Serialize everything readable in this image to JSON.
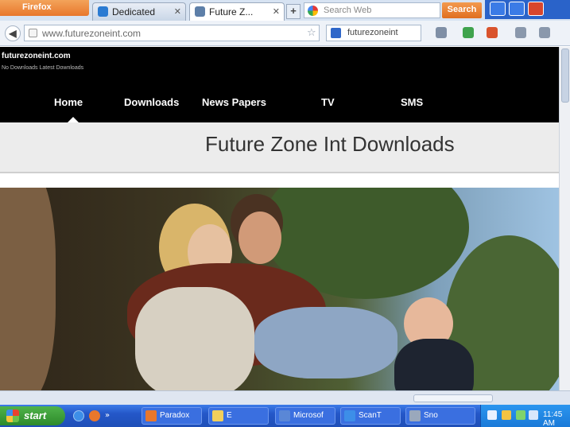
{
  "browser": {
    "menu_button_label": "Firefox",
    "tabs": [
      {
        "label": "Dedicated"
      },
      {
        "label": "Future Z..."
      }
    ],
    "new_tab_label": "+",
    "search_placeholder": "Search Web",
    "search_button_label": "Search",
    "back_label": "◀",
    "address_url": "www.futurezoneint.com",
    "site_search_value": "futurezoneint",
    "accent_color": "#e8772c"
  },
  "website": {
    "domain": "futurezoneint.com",
    "tagline": "No Downloads Latest Downloads",
    "nav": [
      {
        "label": "Home"
      },
      {
        "label": "Downloads"
      },
      {
        "label": "News Papers"
      },
      {
        "label": "TV"
      },
      {
        "label": "SMS"
      }
    ],
    "banner_title": "Future Zone Int Downloads",
    "hero_image": "family-photo"
  },
  "taskbar": {
    "start_label": "start",
    "items": [
      {
        "label": "Paradox",
        "icon": "firefox-icon"
      },
      {
        "label": "E",
        "icon": "folder-icon"
      },
      {
        "label": "Microsof",
        "icon": "window-icon"
      },
      {
        "label": "ScanT",
        "icon": "ie-icon"
      },
      {
        "label": "Sno",
        "icon": "app-icon"
      }
    ],
    "clock": "11:45 AM"
  }
}
